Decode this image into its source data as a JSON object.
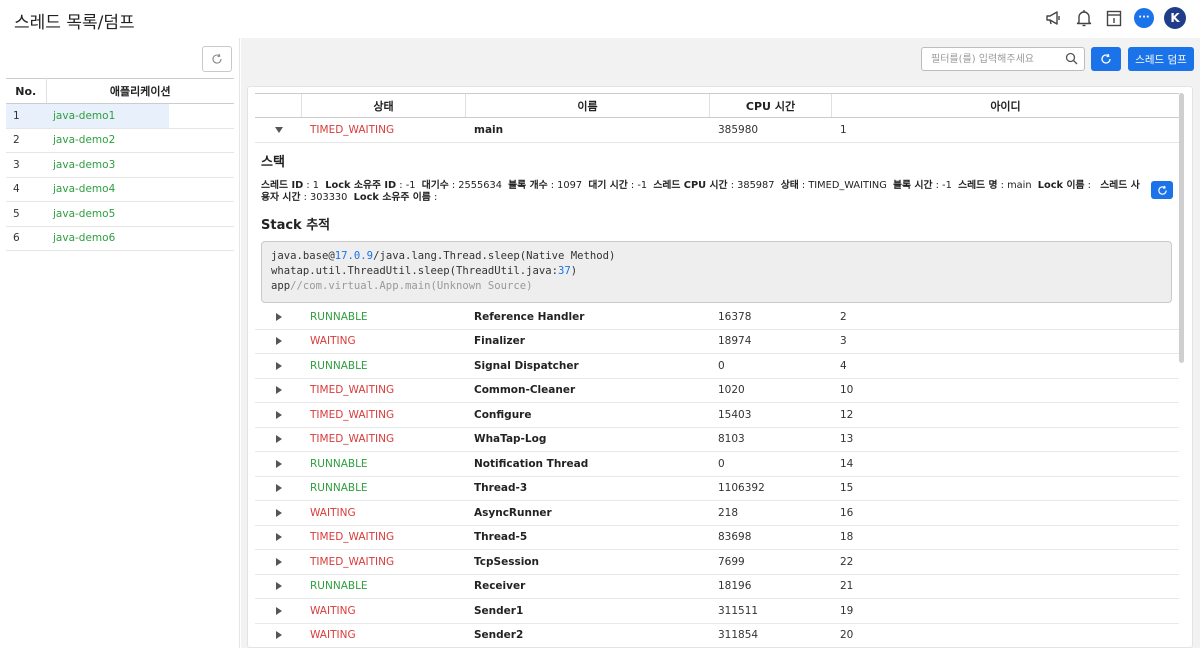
{
  "header": {
    "title": "스레드 목록/덤프",
    "avatar_letter": "K",
    "chat_glyph": "···",
    "icons": [
      "megaphone-icon",
      "bell-icon",
      "document-icon",
      "chat-icon",
      "avatar"
    ]
  },
  "colors": {
    "accent": "#1a73e8",
    "running": "#2e9e3f",
    "waiting": "#d93b3b",
    "avatar": "#1f3d8a"
  },
  "apps": {
    "headers": {
      "no": "No.",
      "name": "애플리케이션"
    },
    "rows": [
      {
        "no": "1",
        "name": "java-demo1"
      },
      {
        "no": "2",
        "name": "java-demo2"
      },
      {
        "no": "3",
        "name": "java-demo3"
      },
      {
        "no": "4",
        "name": "java-demo4"
      },
      {
        "no": "5",
        "name": "java-demo5"
      },
      {
        "no": "6",
        "name": "java-demo6"
      }
    ]
  },
  "toolbar": {
    "search_placeholder": "필터를(를) 입력해주세요",
    "dump_label": "스레드 덤프"
  },
  "threads": {
    "headers": {
      "state": "상태",
      "name": "이름",
      "cpu": "CPU 시간",
      "id": "아이디"
    },
    "main": {
      "state": "TIMED_WAITING",
      "name": "main",
      "cpu": "385980",
      "id": "1"
    },
    "rows": [
      {
        "state": "RUNNABLE",
        "name": "Reference Handler",
        "cpu": "16378",
        "id": "2"
      },
      {
        "state": "WAITING",
        "name": "Finalizer",
        "cpu": "18974",
        "id": "3"
      },
      {
        "state": "RUNNABLE",
        "name": "Signal Dispatcher",
        "cpu": "0",
        "id": "4"
      },
      {
        "state": "TIMED_WAITING",
        "name": "Common-Cleaner",
        "cpu": "1020",
        "id": "10"
      },
      {
        "state": "TIMED_WAITING",
        "name": "Configure",
        "cpu": "15403",
        "id": "12"
      },
      {
        "state": "TIMED_WAITING",
        "name": "WhaTap-Log",
        "cpu": "8103",
        "id": "13"
      },
      {
        "state": "RUNNABLE",
        "name": "Notification Thread",
        "cpu": "0",
        "id": "14"
      },
      {
        "state": "RUNNABLE",
        "name": "Thread-3",
        "cpu": "1106392",
        "id": "15"
      },
      {
        "state": "WAITING",
        "name": "AsyncRunner",
        "cpu": "218",
        "id": "16"
      },
      {
        "state": "TIMED_WAITING",
        "name": "Thread-5",
        "cpu": "83698",
        "id": "18"
      },
      {
        "state": "TIMED_WAITING",
        "name": "TcpSession",
        "cpu": "7699",
        "id": "22"
      },
      {
        "state": "RUNNABLE",
        "name": "Receiver",
        "cpu": "18196",
        "id": "21"
      },
      {
        "state": "WAITING",
        "name": "Sender1",
        "cpu": "311511",
        "id": "19"
      },
      {
        "state": "WAITING",
        "name": "Sender2",
        "cpu": "311854",
        "id": "20"
      }
    ]
  },
  "detail": {
    "stack_title": "스택",
    "info": [
      {
        "label": "스레드 ID",
        "value": "1"
      },
      {
        "label": "Lock 소유주 ID",
        "value": "-1"
      },
      {
        "label": "대기수",
        "value": "2555634"
      },
      {
        "label": "블록 개수",
        "value": "1097"
      },
      {
        "label": "대기 시간",
        "value": "-1"
      },
      {
        "label": "스레드 CPU 시간",
        "value": "385987"
      },
      {
        "label": "상태",
        "value": "TIMED_WAITING"
      },
      {
        "label": "블록 시간",
        "value": "-1"
      },
      {
        "label": "스레드 명",
        "value": "main"
      },
      {
        "label": "Lock 이름",
        "value": ""
      },
      {
        "label": "스레드 사용자 시간",
        "value": "303330"
      },
      {
        "label": "Lock 소유주 이름",
        "value": ""
      }
    ],
    "trace_title": "Stack 추적",
    "trace": {
      "l1_prefix": "java.base@",
      "l1_version": "17.0.9",
      "l1_suffix": "/java.lang.Thread.sleep(Native Method)",
      "l2_prefix": "whatap.util.ThreadUtil.sleep(ThreadUtil.java:",
      "l2_line": "37",
      "l2_suffix": ")",
      "l3_prefix": "app",
      "l3_suffix": "//com.virtual.App.main(Unknown Source)"
    }
  }
}
